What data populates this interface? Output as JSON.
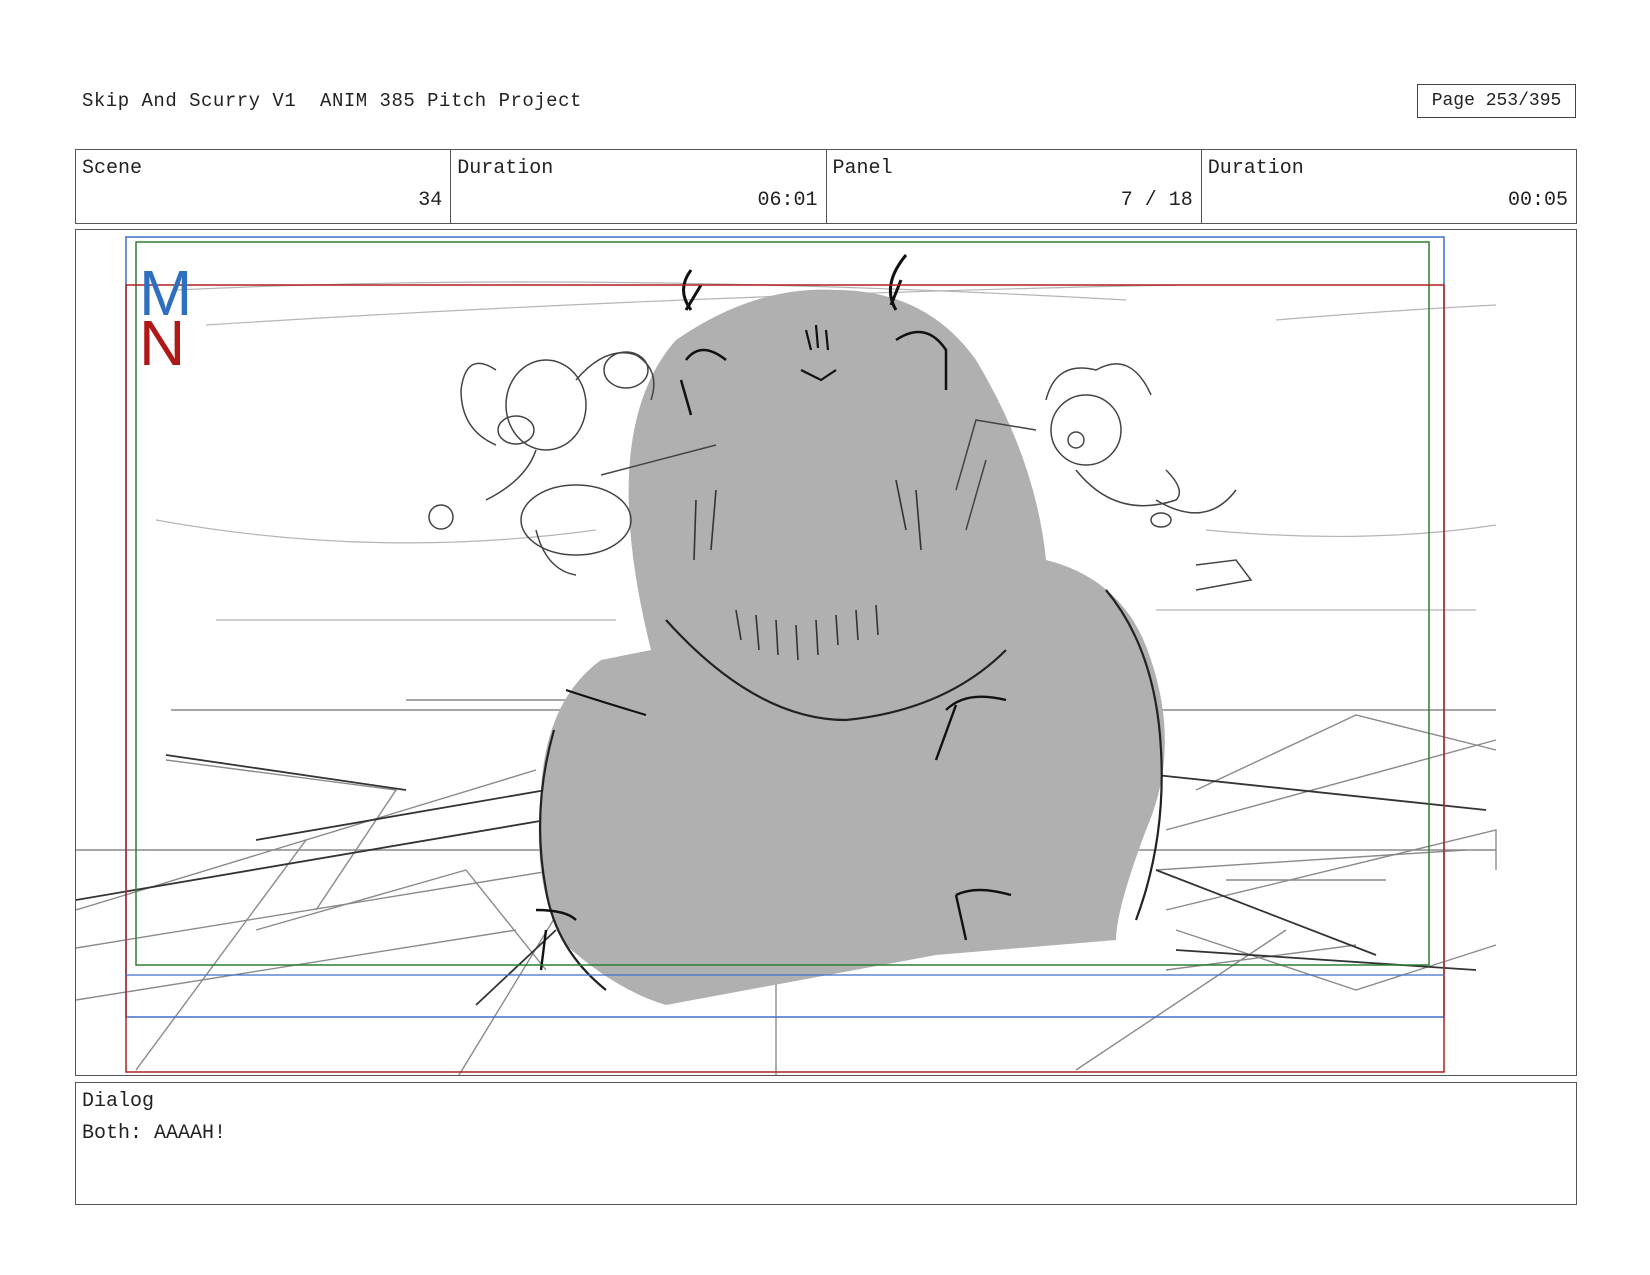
{
  "header": {
    "title": "Skip And Scurry V1  ANIM 385 Pitch Project",
    "page": "Page 253/395"
  },
  "info": {
    "scene_label": "Scene",
    "scene_value": "34",
    "scene_duration_label": "Duration",
    "scene_duration_value": "06:01",
    "panel_label": "Panel",
    "panel_value": "7 / 18",
    "panel_duration_label": "Duration",
    "panel_duration_value": "00:05"
  },
  "logo": {
    "letter_top": "M",
    "letter_bottom": "N",
    "color_top": "#2f6fc0",
    "color_bottom": "#b01818"
  },
  "safe_area_colors": {
    "title_safe": "#2e7d32",
    "action_safe": "#3f6fc9",
    "frame_guide": "#b02020"
  },
  "dialog": {
    "label": "Dialog",
    "text": "Both: AAAAH!"
  }
}
